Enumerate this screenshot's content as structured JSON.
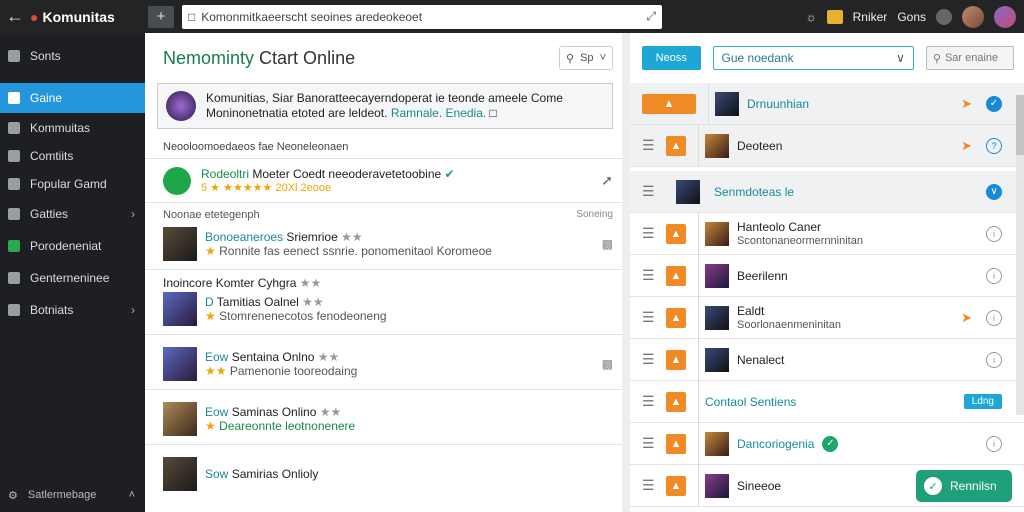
{
  "topbar": {
    "app_name": "Komunitas",
    "search_value": "Komonmitkaeerscht seoines aredeokeoet",
    "right_items": [
      "Rniker",
      "Gons"
    ]
  },
  "sidebar": {
    "items": [
      {
        "label": "Sonts"
      },
      {
        "label": "Gaine"
      },
      {
        "label": "Kommuitas"
      },
      {
        "label": "Comtiits"
      },
      {
        "label": "Fopular Gamd"
      },
      {
        "label": "Gatties"
      },
      {
        "label": "Porodeneniat"
      },
      {
        "label": "Genterneninee"
      },
      {
        "label": "Botniats"
      }
    ],
    "footer_label": "Satlermebage"
  },
  "main": {
    "title_colored": "Nemominty",
    "title_rest": "Ctart Online",
    "filter_label": "Sp",
    "banner": {
      "line1": "Komunitias, Siar Banoratteecayerndoperat ie teonde ameele Come",
      "line2_plain": "Moninonetnatia etoted are leldeot.",
      "line2_accent": "Ramnale. Enedia."
    },
    "section1": "Neooloomoedaeos fae Neoneleonaen",
    "featured": {
      "title_colored": "Rodeoltri",
      "title_rest": "Moeter Coedt neeoderavetetoobine",
      "rating_text": "5 ★ ★★★★★ 20Xl 2eooe"
    },
    "group1": {
      "header": "Noonae etetegenph",
      "header_right": "Soneing",
      "entries": [
        {
          "name_colored": "Bonoeaneroes",
          "name_rest": "Sriemrioe",
          "sub": "Ronnite fas eenect ssnrie. ponomenitaol Koromeoe"
        }
      ]
    },
    "group2": {
      "header": "Inoincore Komter Cyhgra",
      "entries": [
        {
          "name_colored": "D",
          "name_rest": "Tamitias Oalnel",
          "sub": "Stomrenenecotos fenodeoneng"
        }
      ]
    },
    "group3": {
      "entries": [
        {
          "name_colored": "Eow",
          "name_rest": "Sentaina Onlno",
          "sub": "Pamenonie tooreodaing"
        }
      ]
    },
    "group4": {
      "entries": [
        {
          "name_colored": "Eow",
          "name_rest": "Saminas Onlino",
          "sub": "Deareonnte leotnonenere"
        }
      ]
    },
    "group5": {
      "entries": [
        {
          "name_colored": "Sow",
          "name_rest": "Samirias Onlioly",
          "sub": ""
        }
      ]
    }
  },
  "right": {
    "btn_label": "Neoss",
    "select_value": "Gue noedank",
    "search_placeholder": "Sar enaine",
    "rows": [
      {
        "name": "Drnuunhian",
        "sub": "",
        "style": "c"
      },
      {
        "name": "Deoteen",
        "sub": ""
      },
      {
        "name": "Senmdoteas le",
        "sub": "",
        "style": "c"
      },
      {
        "name": "Hanteolo Caner",
        "sub": "Scontonaneormernninitan"
      },
      {
        "name": "Beerilenn",
        "sub": ""
      },
      {
        "name": "Ealdt",
        "sub": "Soorlonaenmeninitan"
      },
      {
        "name": "Nenalect",
        "sub": ""
      },
      {
        "name": "Contaol Sentiens",
        "sub": "",
        "style": "c"
      },
      {
        "name": "Dancoriogenia",
        "sub": "",
        "style": "c"
      },
      {
        "name": "Sineeoe",
        "sub": ""
      }
    ],
    "pill_label": "Ldng",
    "chat_label": "Rennilsn"
  }
}
